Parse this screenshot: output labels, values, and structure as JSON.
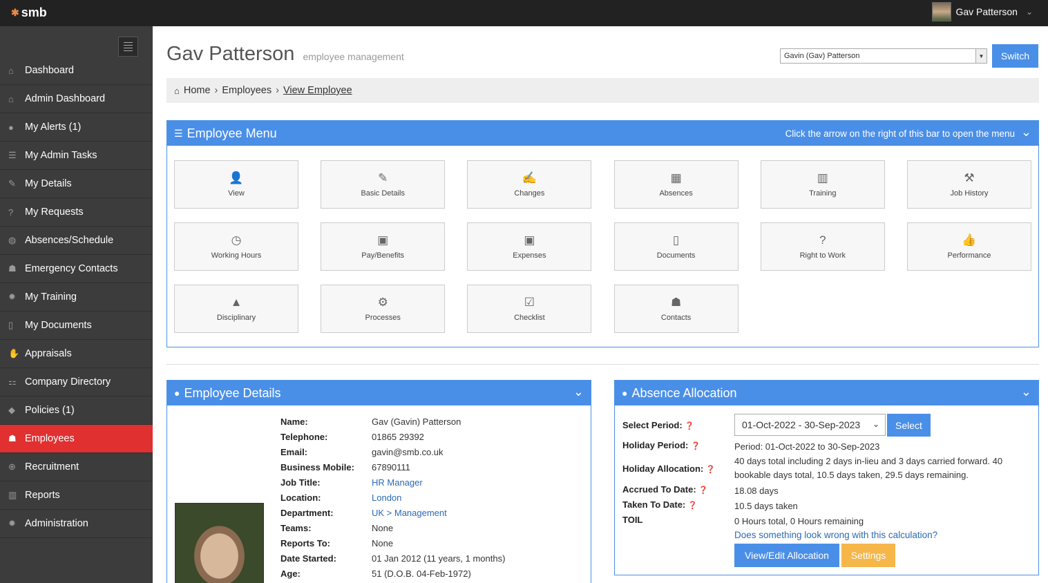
{
  "topbar": {
    "logo": "smb",
    "user_name": "Gav Patterson"
  },
  "sidebar": {
    "items": [
      {
        "label": "Dashboard",
        "icon": "home-icon",
        "glyph": "⌂"
      },
      {
        "label": "Admin Dashboard",
        "icon": "home-icon",
        "glyph": "⌂"
      },
      {
        "label": "My Alerts (1)",
        "icon": "alert-icon",
        "glyph": "●"
      },
      {
        "label": "My Admin Tasks",
        "icon": "tasks-icon",
        "glyph": "☰"
      },
      {
        "label": "My Details",
        "icon": "edit-icon",
        "glyph": "✎"
      },
      {
        "label": "My Requests",
        "icon": "question-icon",
        "glyph": "?"
      },
      {
        "label": "Absences/Schedule",
        "icon": "globe-icon",
        "glyph": "◍"
      },
      {
        "label": "Emergency Contacts",
        "icon": "users-icon",
        "glyph": "☗"
      },
      {
        "label": "My Training",
        "icon": "gear-icon",
        "glyph": "✹"
      },
      {
        "label": "My Documents",
        "icon": "file-icon",
        "glyph": "▯"
      },
      {
        "label": "Appraisals",
        "icon": "thumbs-up-icon",
        "glyph": "✋"
      },
      {
        "label": "Company Directory",
        "icon": "sitemap-icon",
        "glyph": "⚏"
      },
      {
        "label": "Policies (1)",
        "icon": "tags-icon",
        "glyph": "◆"
      },
      {
        "label": "Employees",
        "icon": "users-icon",
        "glyph": "☗",
        "active": true
      },
      {
        "label": "Recruitment",
        "icon": "plus-circle-icon",
        "glyph": "⊕"
      },
      {
        "label": "Reports",
        "icon": "bar-chart-icon",
        "glyph": "▥"
      },
      {
        "label": "Administration",
        "icon": "gears-icon",
        "glyph": "✹"
      }
    ]
  },
  "header": {
    "title": "Gav Patterson",
    "subtitle": "employee management",
    "switch_select_value": "Gavin (Gav) Patterson",
    "switch_label": "Switch"
  },
  "breadcrumb": {
    "home": "Home",
    "employees": "Employees",
    "current": "View Employee"
  },
  "employee_menu": {
    "title": "Employee Menu",
    "hint": "Click the arrow on the right of this bar to open the menu",
    "tiles": [
      {
        "label": "View",
        "icon": "user-icon",
        "glyph": "👤"
      },
      {
        "label": "Basic Details",
        "icon": "pencil-icon",
        "glyph": "✎"
      },
      {
        "label": "Changes",
        "icon": "edit-icon",
        "glyph": "✍"
      },
      {
        "label": "Absences",
        "icon": "calendar-icon",
        "glyph": "▦"
      },
      {
        "label": "Training",
        "icon": "bar-chart-icon",
        "glyph": "▥"
      },
      {
        "label": "Job History",
        "icon": "gavel-icon",
        "glyph": "⚒"
      },
      {
        "label": "Working Hours",
        "icon": "clock-icon",
        "glyph": "◷"
      },
      {
        "label": "Pay/Benefits",
        "icon": "money-icon",
        "glyph": "▣"
      },
      {
        "label": "Expenses",
        "icon": "money-icon",
        "glyph": "▣"
      },
      {
        "label": "Documents",
        "icon": "file-icon",
        "glyph": "▯"
      },
      {
        "label": "Right to Work",
        "icon": "question-circle-icon",
        "glyph": "?"
      },
      {
        "label": "Performance",
        "icon": "thumbs-up-icon",
        "glyph": "👍"
      },
      {
        "label": "Disciplinary",
        "icon": "warning-icon",
        "glyph": "▲"
      },
      {
        "label": "Processes",
        "icon": "gears-icon",
        "glyph": "⚙"
      },
      {
        "label": "Checklist",
        "icon": "check-square-icon",
        "glyph": "☑"
      },
      {
        "label": "Contacts",
        "icon": "users-icon",
        "glyph": "☗"
      }
    ]
  },
  "employee_details": {
    "title": "Employee Details",
    "rows": [
      {
        "label": "Name:",
        "value": "Gav (Gavin) Patterson",
        "link": false
      },
      {
        "label": "Telephone:",
        "value": "01865 29392",
        "link": false
      },
      {
        "label": "Email:",
        "value": "gavin@smb.co.uk",
        "link": false
      },
      {
        "label": "Business Mobile:",
        "value": "67890111",
        "link": false
      },
      {
        "label": "Job Title:",
        "value": "HR Manager",
        "link": true
      },
      {
        "label": "Location:",
        "value": "London",
        "link": true
      },
      {
        "label": "Department:",
        "value": "UK > Management",
        "link": true
      },
      {
        "label": "Teams:",
        "value": "None",
        "link": false
      },
      {
        "label": "Reports To:",
        "value": "None",
        "link": false
      },
      {
        "label": "Date Started:",
        "value": "01 Jan 2012 (11 years, 1 months)",
        "link": false
      },
      {
        "label": "Age:",
        "value": "51 (D.O.B. 04-Feb-1972)",
        "link": false
      }
    ]
  },
  "absence_allocation": {
    "title": "Absence Allocation",
    "select_period_label": "Select Period:",
    "period_value": "01-Oct-2022 - 30-Sep-2023",
    "select_label": "Select",
    "holiday_period_label": "Holiday Period:",
    "holiday_period_value": "Period: 01-Oct-2022 to 30-Sep-2023",
    "holiday_allocation_label": "Holiday Allocation:",
    "holiday_allocation_value": "40 days total including 2 days in-lieu and 3 days carried forward. 40 bookable days total, 10.5 days taken, 29.5 days remaining.",
    "accrued_label": "Accrued To Date:",
    "accrued_value": "18.08 days",
    "taken_label": "Taken To Date:",
    "taken_value": "10.5 days taken",
    "toil_label": "TOIL",
    "toil_value": "0 Hours total, 0 Hours remaining",
    "wrong_link": "Does something look wrong with this calculation?",
    "edit_label": "View/Edit Allocation",
    "settings_label": "Settings"
  },
  "colors": {
    "accent": "#4a8fe7",
    "active_nav": "#e03030",
    "warning_button": "#f5b64a",
    "sidebar": "#3c3c3c",
    "topbar": "#222222"
  }
}
